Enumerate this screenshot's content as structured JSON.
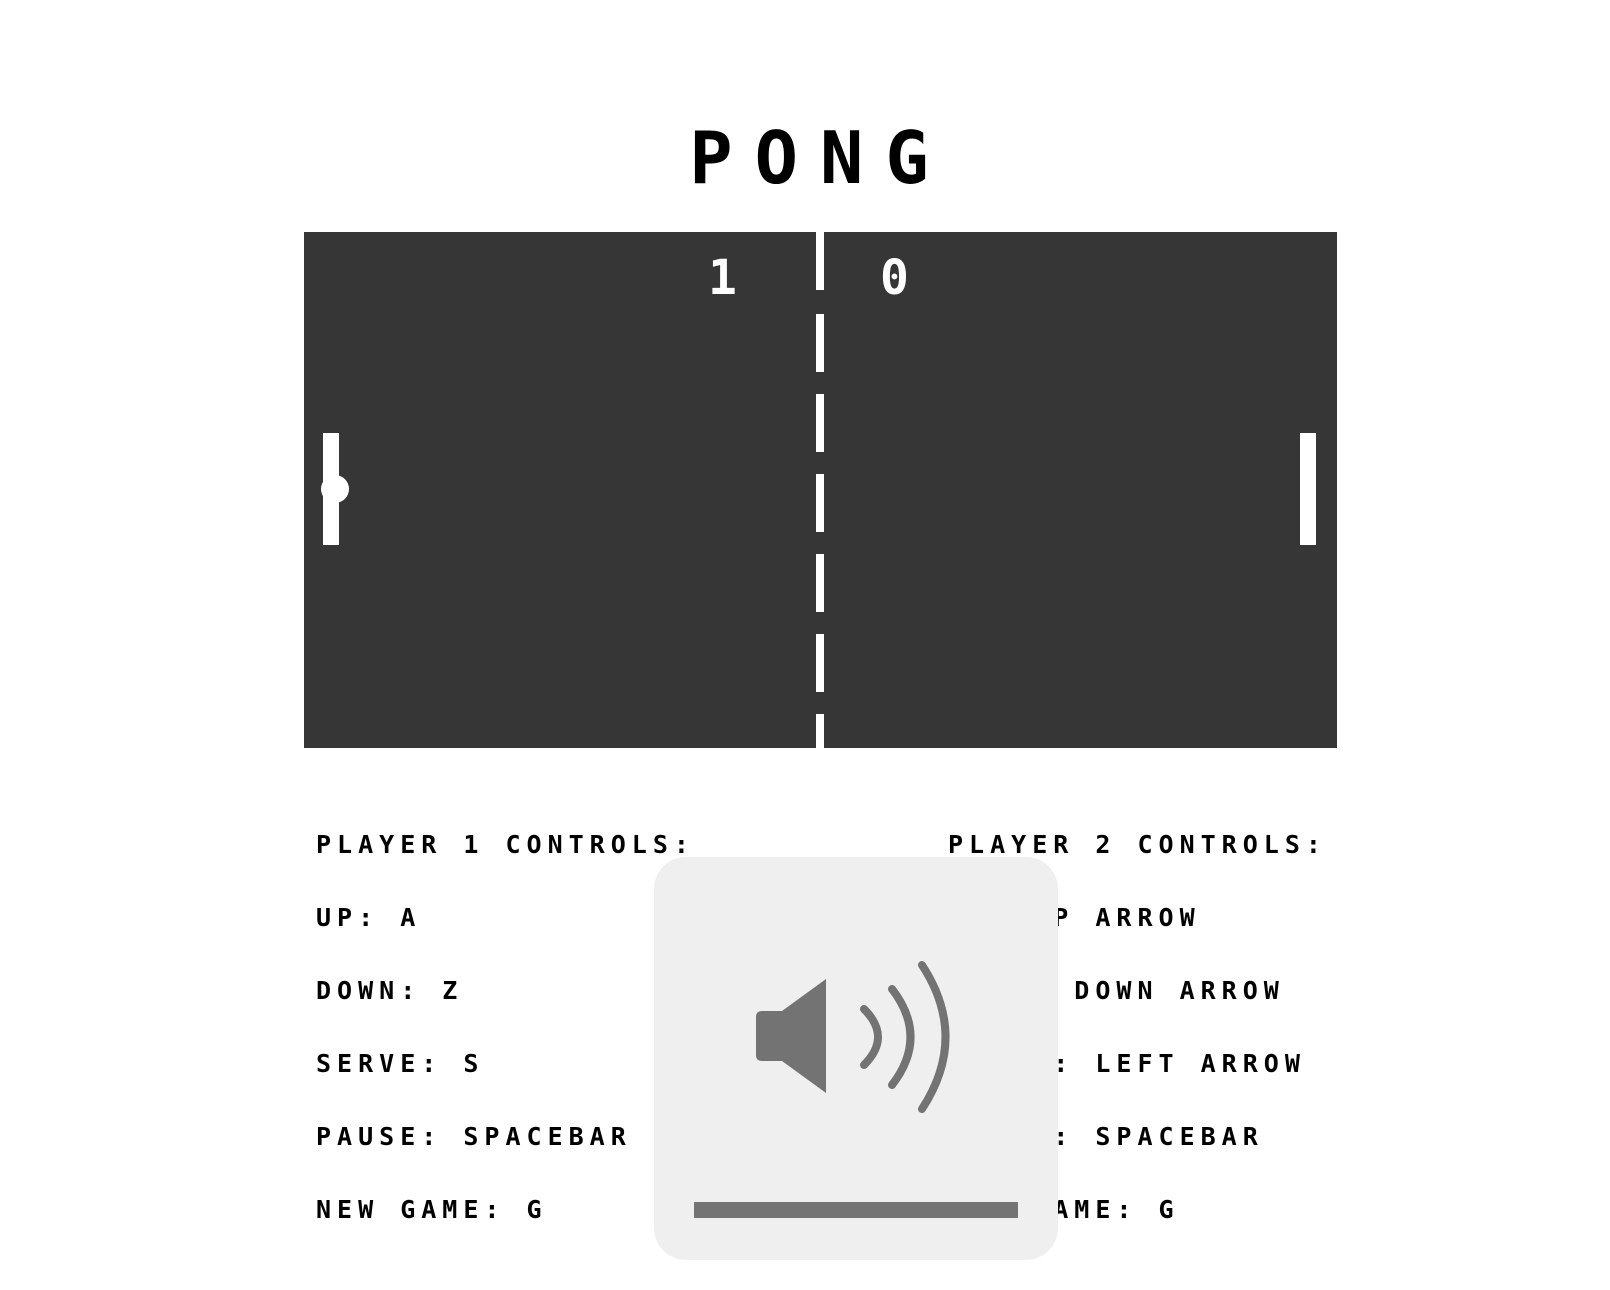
{
  "title": "PONG",
  "scores": {
    "player1": "1",
    "player2": "0"
  },
  "player1_controls": {
    "heading": "PLAYER 1 CONTROLS:",
    "items": [
      "UP: A",
      "DOWN: Z",
      "SERVE: S",
      "PAUSE: SPACEBAR",
      "NEW GAME: G"
    ]
  },
  "player2_controls": {
    "heading": "PLAYER 2 CONTROLS:",
    "items": [
      "UP: UP ARROW",
      "DOWN: DOWN ARROW",
      "SERVE: LEFT ARROW",
      "PAUSE: SPACEBAR",
      "NEW GAME: G"
    ]
  },
  "volume_overlay": {
    "icon": "speaker-volume-icon",
    "level": 1.0
  },
  "colors": {
    "court": "#363636",
    "overlay_bg": "#efefef",
    "overlay_icon": "#737373"
  }
}
